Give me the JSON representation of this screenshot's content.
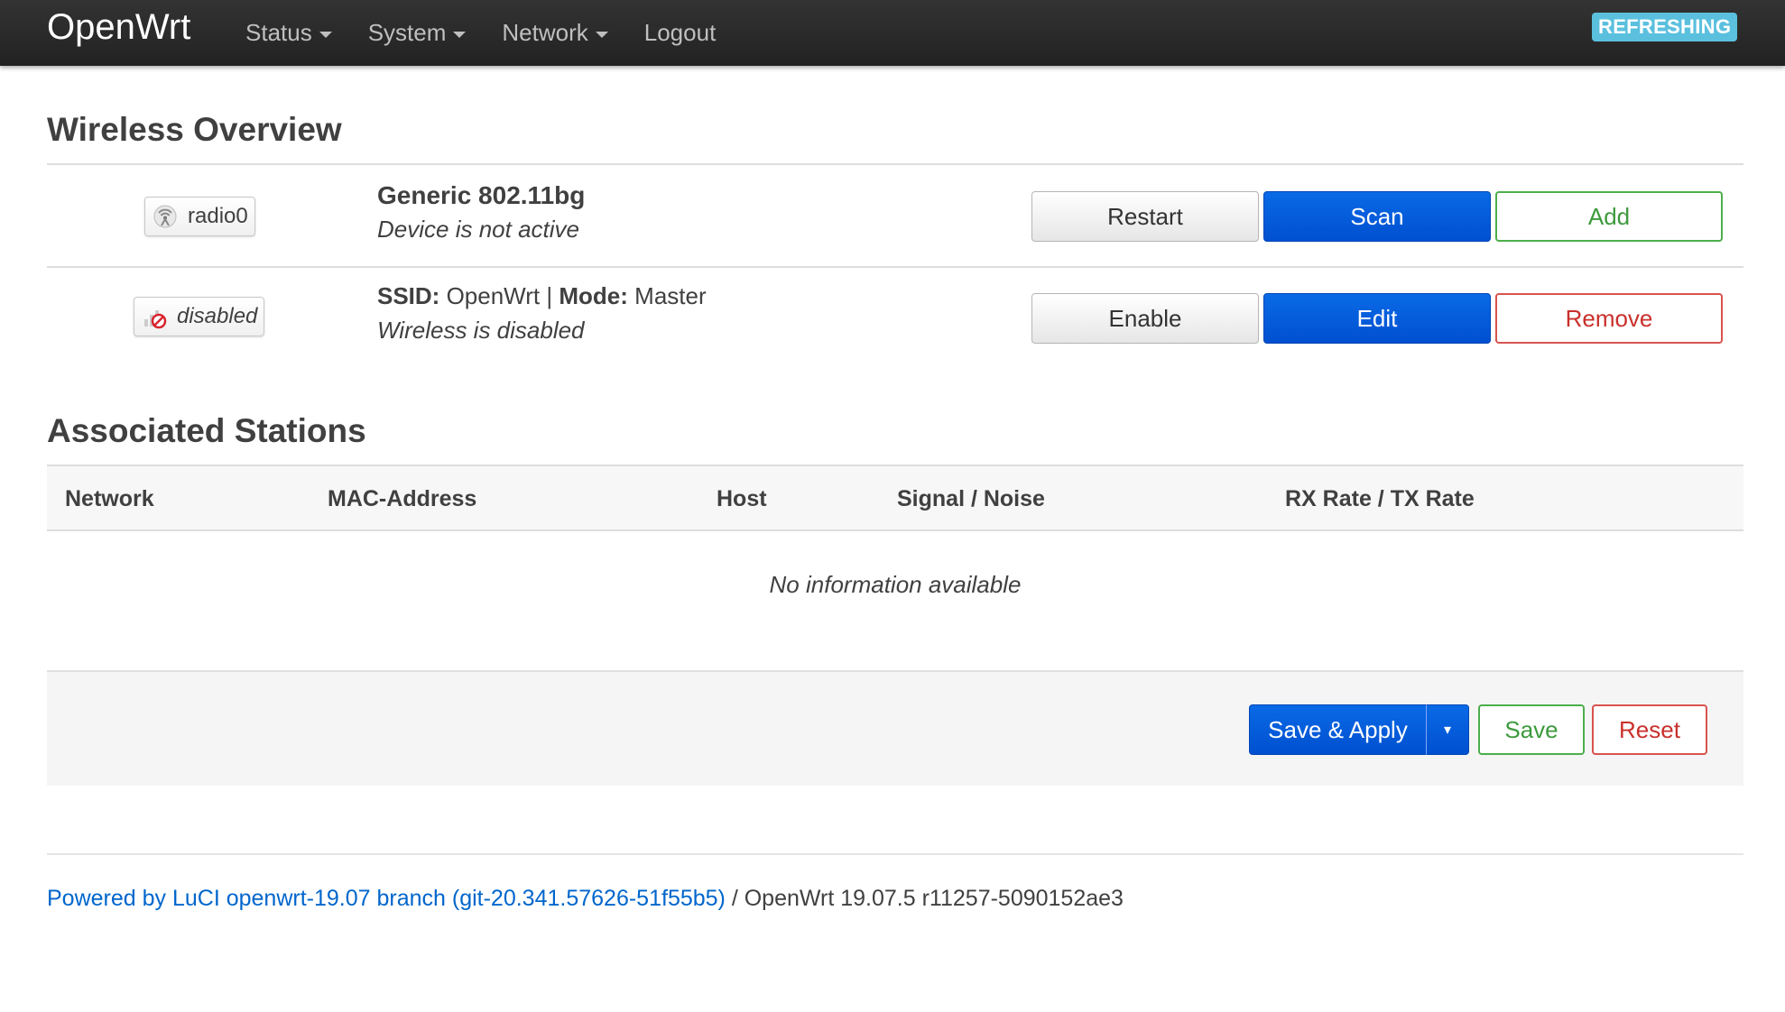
{
  "header": {
    "brand": "OpenWrt",
    "menu": [
      {
        "label": "Status",
        "dropdown": true
      },
      {
        "label": "System",
        "dropdown": true
      },
      {
        "label": "Network",
        "dropdown": true
      },
      {
        "label": "Logout",
        "dropdown": false
      }
    ],
    "status_badge": "REFRESHING"
  },
  "wireless_overview": {
    "title": "Wireless Overview",
    "device": {
      "badge_label": "radio0",
      "badge_icon": "wifi-radio-icon",
      "name": "Generic 802.11bg",
      "status": "Device is not active",
      "buttons": {
        "restart": "Restart",
        "scan": "Scan",
        "add": "Add"
      }
    },
    "network": {
      "badge_label": "disabled",
      "badge_icon": "wifi-disabled-icon",
      "ssid_label": "SSID:",
      "ssid_value": "OpenWrt",
      "separator": "|",
      "mode_label": "Mode:",
      "mode_value": "Master",
      "status": "Wireless is disabled",
      "buttons": {
        "enable": "Enable",
        "edit": "Edit",
        "remove": "Remove"
      }
    }
  },
  "associated_stations": {
    "title": "Associated Stations",
    "columns": [
      "Network",
      "MAC-Address",
      "Host",
      "Signal / Noise",
      "RX Rate / TX Rate"
    ],
    "empty_text": "No information available"
  },
  "actions": {
    "save_apply": "Save & Apply",
    "save_apply_toggle": "▾",
    "save": "Save",
    "reset": "Reset"
  },
  "footer": {
    "link_text": "Powered by LuCI openwrt-19.07 branch (git-20.341.57626-51f55b5)",
    "version_text": " / OpenWrt 19.07.5 r11257-5090152ae3"
  },
  "colors": {
    "primary": "#0055d4",
    "success": "#4cae4c",
    "danger": "#d9534f",
    "info": "#5bc0de",
    "header_bg": "#2a2a2a"
  }
}
